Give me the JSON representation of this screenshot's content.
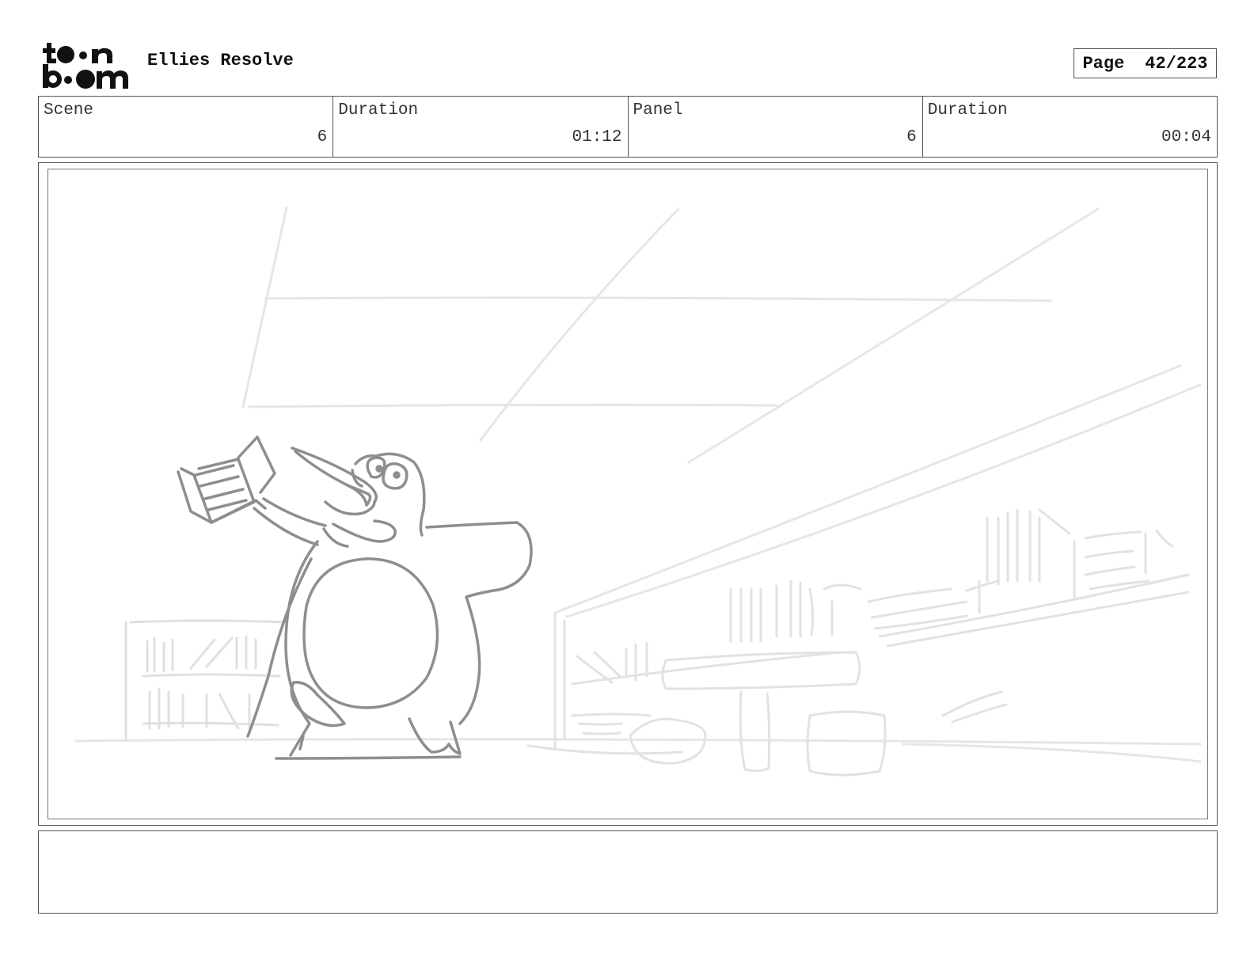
{
  "header": {
    "logo_top": "toon",
    "logo_bottom": "boom",
    "project_title": "Ellies Resolve",
    "page_label": "Page",
    "page_value": "42/223"
  },
  "info": {
    "scene_label": "Scene",
    "scene_value": "6",
    "scene_duration_label": "Duration",
    "scene_duration_value": "01:12",
    "panel_label": "Panel",
    "panel_value": "6",
    "panel_duration_label": "Duration",
    "panel_duration_value": "00:04"
  },
  "notes": {
    "text": ""
  }
}
